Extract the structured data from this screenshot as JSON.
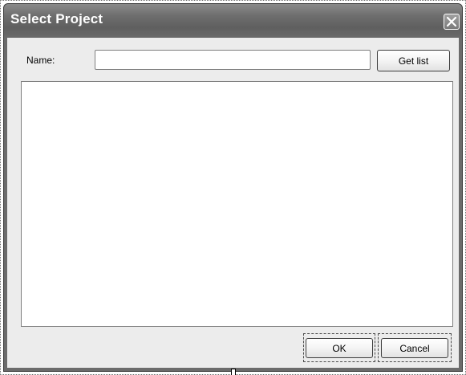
{
  "window": {
    "title": "Select Project",
    "close_icon": "close-icon"
  },
  "form": {
    "name_label": "Name:",
    "name_value": "",
    "get_list_label": "Get list"
  },
  "list": {
    "items": []
  },
  "footer": {
    "ok_label": "OK",
    "cancel_label": "Cancel"
  },
  "colors": {
    "titlebar": "#6e6e6e",
    "client_background": "#ececec",
    "list_background": "#ffffff"
  }
}
